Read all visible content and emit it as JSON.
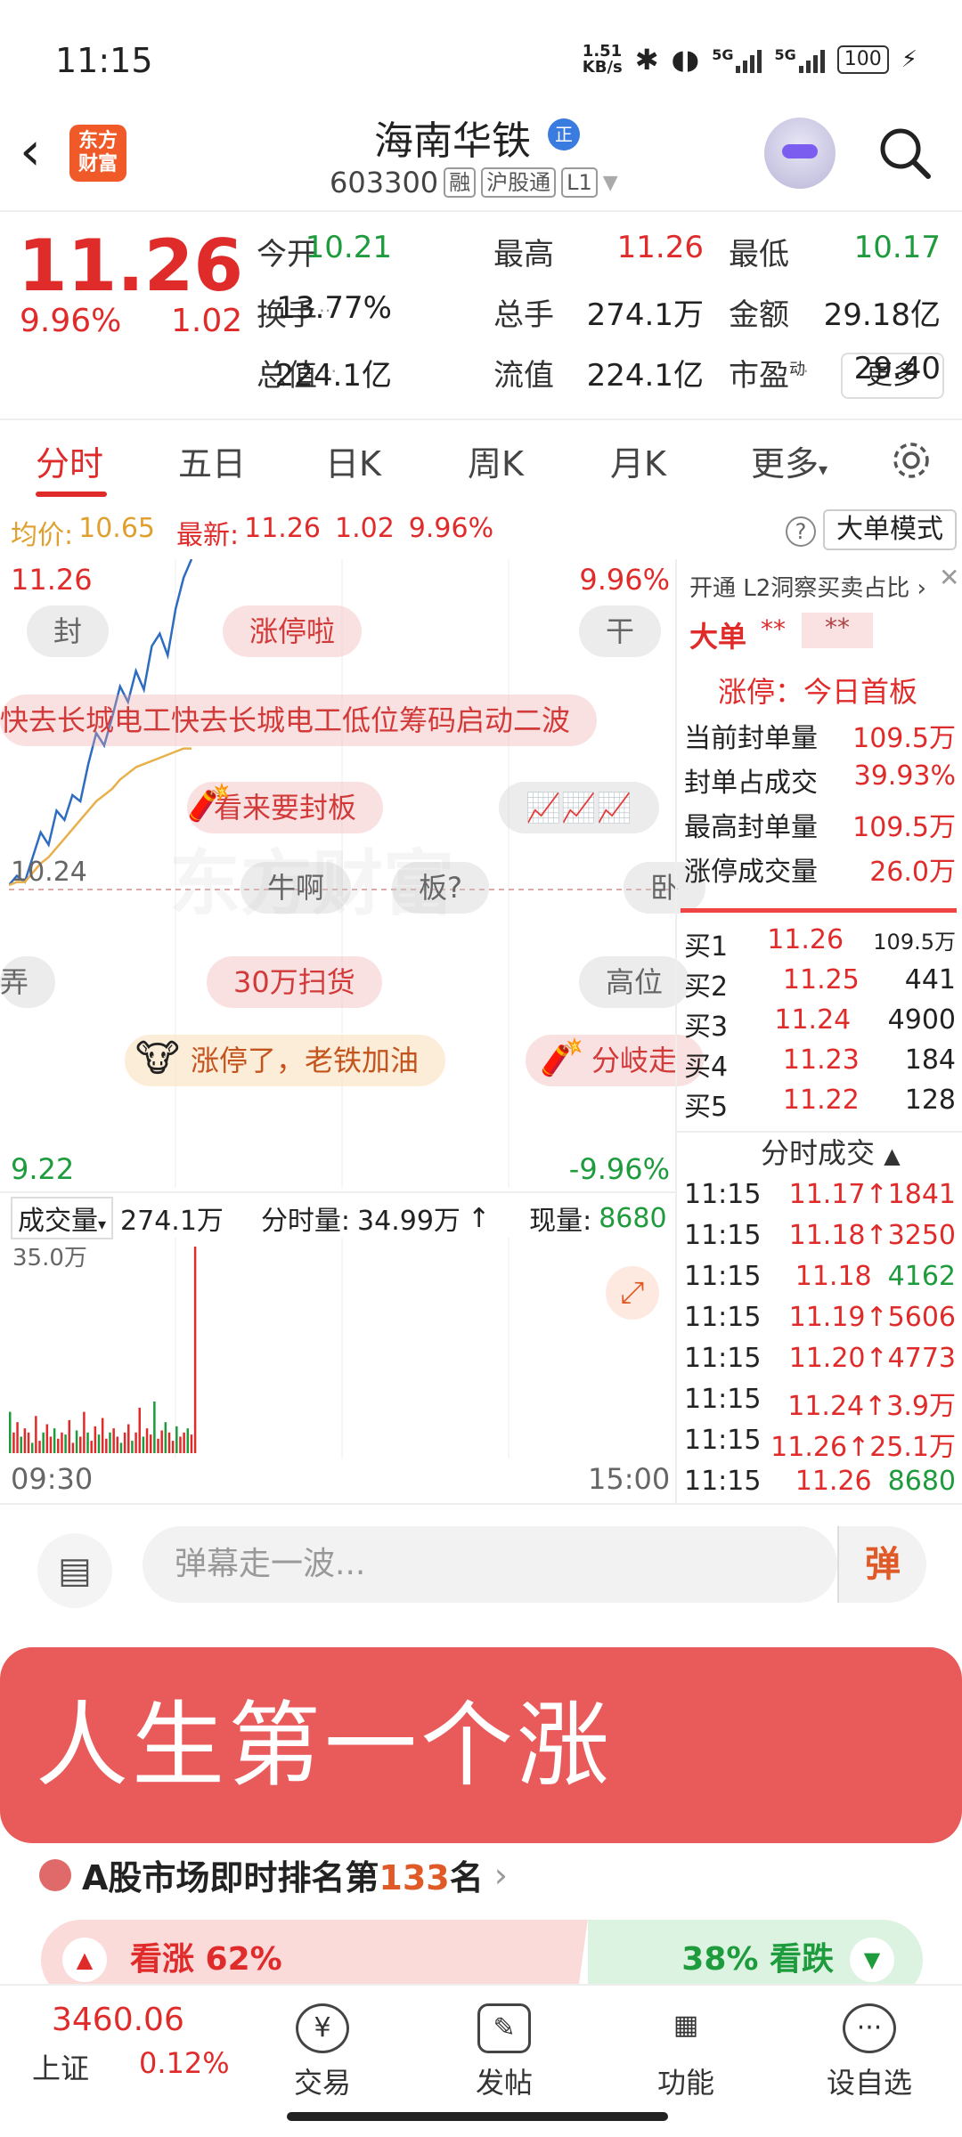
{
  "status_bar": {
    "time": "11:15",
    "net_speed": "1.51\nKB/s",
    "net_type_1": "5G",
    "net_type_2": "5G",
    "battery": "100"
  },
  "header": {
    "logo_text": "东方\n财富",
    "stock_name": "海南华铁",
    "badge": "正",
    "code": "603300",
    "tags": [
      "融",
      "沪股通",
      "L1"
    ]
  },
  "quote": {
    "price": "11.26",
    "pct": "9.96%",
    "change": "1.02",
    "fields": [
      {
        "label": "今开",
        "value": "10.21",
        "color": "green"
      },
      {
        "label": "最高",
        "value": "11.26",
        "color": "red"
      },
      {
        "label": "最低",
        "value": "10.17",
        "color": "green"
      },
      {
        "label": "换手",
        "value": "13.77%",
        "color": "dark"
      },
      {
        "label": "总手",
        "value": "274.1万",
        "color": "dark"
      },
      {
        "label": "金额",
        "value": "29.18亿",
        "color": "dark"
      },
      {
        "label": "总值",
        "value": "224.1亿",
        "color": "dark"
      },
      {
        "label": "流值",
        "value": "224.1亿",
        "color": "dark"
      },
      {
        "label": "市盈",
        "value": "29.40",
        "color": "dark"
      }
    ],
    "pe_superscript": "动",
    "more_label": "更多"
  },
  "tabs": [
    "分时",
    "五日",
    "日K",
    "周K",
    "月K",
    "更多"
  ],
  "avg_row": {
    "avg_label": "均价:",
    "avg_value": "10.65",
    "latest_label": "最新:",
    "latest_value": "11.26",
    "change": "1.02",
    "pct": "9.96%",
    "bigorder_label": "大单模式"
  },
  "chart": {
    "top_price": "11.26",
    "top_pct": "9.96%",
    "bottom_price": "9.22",
    "bottom_pct": "-9.96%",
    "mid_price": "10.24",
    "watermark": "东方财富",
    "danmu": [
      "封",
      "涨停啦",
      "干",
      "快去长城电工快去长城电工低位筹码启动二波",
      "看来要封板",
      "牛啊",
      "板?",
      "卧",
      "弄",
      "30万扫货",
      "高位",
      "涨停了，老铁加油",
      "分岐走"
    ]
  },
  "chart_data": {
    "type": "line",
    "x_start": "09:30",
    "x_end": "15:00",
    "ylim": [
      9.22,
      11.26
    ],
    "series": [
      {
        "values": [
          10.21,
          10.24,
          10.22,
          10.3,
          10.38,
          10.34,
          10.45,
          10.42,
          10.5,
          10.48,
          10.6,
          10.7,
          10.66,
          10.75,
          10.85,
          10.8,
          10.9,
          10.84,
          10.98,
          11.02,
          10.95,
          11.1,
          11.2,
          11.26
        ]
      },
      {
        "values": [
          10.21,
          10.22,
          10.22,
          10.25,
          10.28,
          10.3,
          10.33,
          10.36,
          10.39,
          10.42,
          10.45,
          10.48,
          10.5,
          10.52,
          10.55,
          10.57,
          10.59,
          10.6,
          10.61,
          10.62,
          10.63,
          10.64,
          10.65,
          10.65
        ]
      }
    ]
  },
  "volume": {
    "label": "成交量",
    "total": "274.1万",
    "min_vol_label": "分时量:",
    "min_vol_value": "34.99万",
    "cur_label": "现量:",
    "cur_value": "8680",
    "scale": "35.0万",
    "x_start": "09:30",
    "x_end": "15:00",
    "bars": [
      0.2,
      0.1,
      0.15,
      0.08,
      0.12,
      0.1,
      0.05,
      0.18,
      0.06,
      0.1,
      0.14,
      0.08,
      0.12,
      0.07,
      0.1,
      0.09,
      0.16,
      0.05,
      0.11,
      0.08,
      0.2,
      0.1,
      0.06,
      0.13,
      0.09,
      0.17,
      0.07,
      0.1,
      0.12,
      0.08,
      0.05,
      0.1,
      0.14,
      0.06,
      0.1,
      0.22,
      0.08,
      0.12,
      0.09,
      0.25,
      0.07,
      0.11,
      0.15,
      0.1,
      0.06,
      0.13,
      0.08,
      0.1,
      0.12,
      0.09,
      1.0
    ]
  },
  "right_panel": {
    "l2_label": "开通 L2洞察买卖占比",
    "big_order_label": "大单",
    "big_order_mask1": "**",
    "big_order_mask2": "**",
    "limit_status": "涨停：今日首板",
    "stats": [
      {
        "label": "当前封单量",
        "value": "109.5万"
      },
      {
        "label": "封单占成交",
        "value": "39.93%"
      },
      {
        "label": "最高封单量",
        "value": "109.5万"
      },
      {
        "label": "涨停成交量",
        "value": "26.0万"
      }
    ],
    "bids": [
      {
        "label": "买1",
        "price": "11.26",
        "vol": "109.5万"
      },
      {
        "label": "买2",
        "price": "11.25",
        "vol": "441"
      },
      {
        "label": "买3",
        "price": "11.24",
        "vol": "4900"
      },
      {
        "label": "买4",
        "price": "11.23",
        "vol": "184"
      },
      {
        "label": "买5",
        "price": "11.22",
        "vol": "128"
      }
    ],
    "ticks_label": "分时成交",
    "ticks": [
      {
        "time": "11:15",
        "price": "11.17",
        "vol": "1841",
        "up": true
      },
      {
        "time": "11:15",
        "price": "11.18",
        "vol": "3250",
        "up": true
      },
      {
        "time": "11:15",
        "price": "11.18",
        "vol": "4162",
        "up": false
      },
      {
        "time": "11:15",
        "price": "11.19",
        "vol": "5606",
        "up": true
      },
      {
        "time": "11:15",
        "price": "11.20",
        "vol": "4773",
        "up": true
      },
      {
        "time": "11:15",
        "price": "11.24",
        "vol": "3.9万",
        "up": true
      },
      {
        "time": "11:15",
        "price": "11.26",
        "vol": "25.1万",
        "up": true
      },
      {
        "time": "11:15",
        "price": "11.26",
        "vol": "8680",
        "up": false
      }
    ]
  },
  "comment": {
    "placeholder": "弹幕走一波...",
    "dan_label": "弹"
  },
  "banner": {
    "text": "人生第一个涨停！！！"
  },
  "rank": {
    "prefix": "A股市场即时排名第",
    "num": "133",
    "suffix": "名"
  },
  "vote": {
    "up_label": "看涨 62%",
    "down_label": "38% 看跌",
    "up_ratio": 0.62
  },
  "bottom_nav": {
    "index_value": "3460.06",
    "index_name": "上证",
    "index_pct": "0.12%",
    "items": [
      "交易",
      "发帖",
      "功能",
      "设自选"
    ]
  }
}
